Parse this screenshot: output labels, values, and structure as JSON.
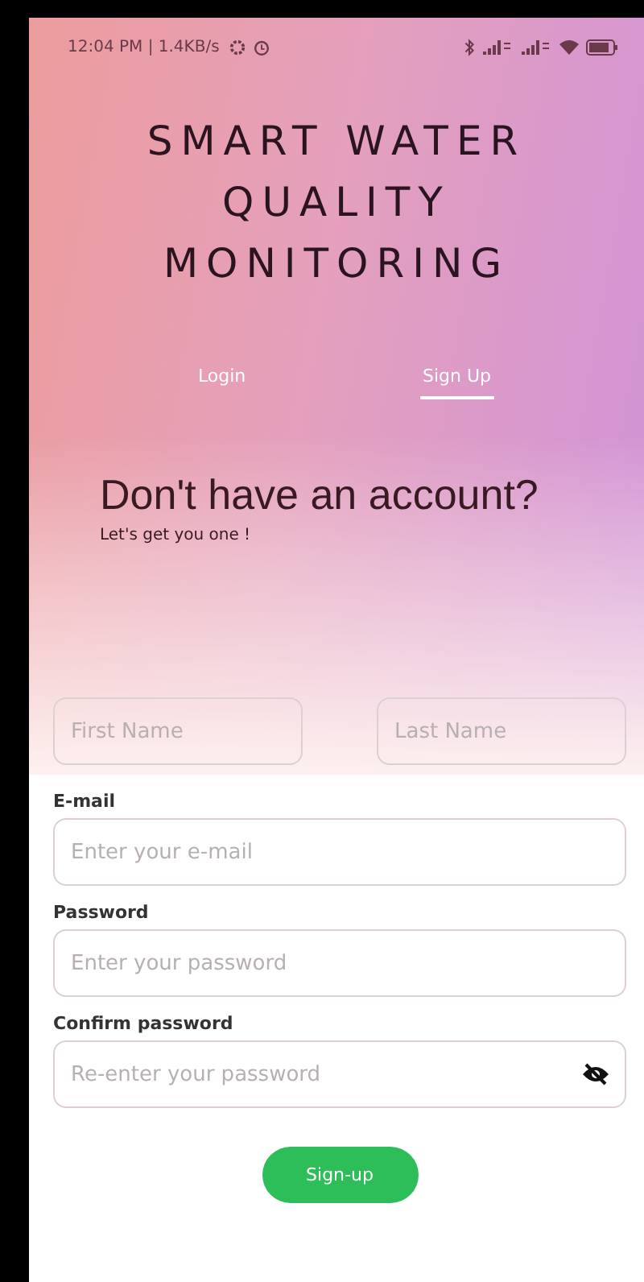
{
  "status_bar": {
    "time": "12:04 PM | 1.4KB/s"
  },
  "app_title": [
    "SMART WATER",
    "QUALITY",
    "MONITORING"
  ],
  "tabs": [
    {
      "label": "Login",
      "selected": false
    },
    {
      "label": "Sign Up",
      "selected": true
    }
  ],
  "heading": "Don't have an account?",
  "subheading": "Let's get you one !",
  "name_fields": [
    {
      "placeholder": "First Name"
    },
    {
      "placeholder": "Last Name"
    }
  ],
  "fields": [
    {
      "label": "E-mail",
      "placeholder": "Enter your e-mail",
      "password_toggle": false
    },
    {
      "label": "Password",
      "placeholder": "Enter your password",
      "password_toggle": false
    },
    {
      "label": "Confirm password",
      "placeholder": "Re-enter your password",
      "password_toggle": true
    }
  ],
  "submit_button": "Sign-up"
}
